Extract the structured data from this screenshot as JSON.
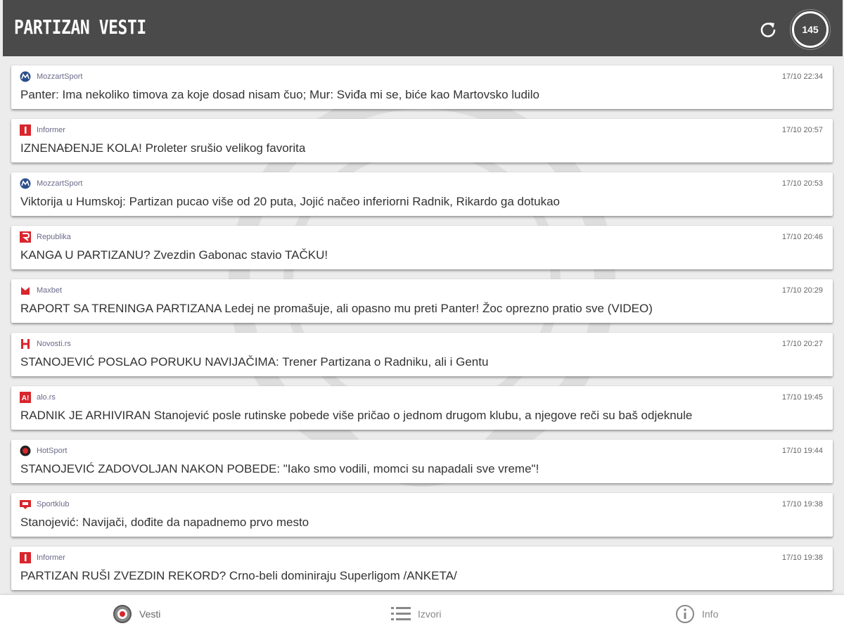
{
  "header": {
    "title": "PARTIZAN VESTI",
    "badge_count": "145"
  },
  "news": [
    {
      "source": "MozzartSport",
      "icon": "mozzart",
      "time": "17/10 22:34",
      "title": "Panter: Ima nekoliko timova za koje dosad nisam čuo; Mur: Sviđa mi se, biće kao Martovsko ludilo"
    },
    {
      "source": "Informer",
      "icon": "informer",
      "time": "17/10 20:57",
      "title": "IZNENAĐENJE KOLA! Proleter srušio velikog favorita"
    },
    {
      "source": "MozzartSport",
      "icon": "mozzart",
      "time": "17/10 20:53",
      "title": "Viktorija u Humskoj: Partizan pucao više od 20 puta, Jojić načeo inferiorni Radnik, Rikardo ga dotukao"
    },
    {
      "source": "Republika",
      "icon": "republika",
      "time": "17/10 20:46",
      "title": "KANGA U PARTIZANU? Zvezdin Gabonac stavio TAČKU!"
    },
    {
      "source": "Maxbet",
      "icon": "maxbet",
      "time": "17/10 20:29",
      "title": "RAPORT SA TRENINGA PARTIZANA Ledej ne promašuje, ali opasno mu preti Panter! Žoc oprezno pratio sve (VIDEO)"
    },
    {
      "source": "Novosti.rs",
      "icon": "novosti",
      "time": "17/10 20:27",
      "title": "STANOJEVIĆ POSLAO PORUKU NAVIJAČIMA: Trener Partizana o Radniku, ali i Gentu"
    },
    {
      "source": "alo.rs",
      "icon": "alo",
      "time": "17/10 19:45",
      "title": "RADNIK JE ARHIVIRAN Stanojević posle rutinske pobede više pričao o jednom drugom klubu, a njegove reči su baš odjeknule"
    },
    {
      "source": "HotSport",
      "icon": "hotsport",
      "time": "17/10 19:44",
      "title": "STANOJEVIĆ ZADOVOLJAN NAKON POBEDE: \"Iako smo vodili, momci su napadali sve vreme\"!"
    },
    {
      "source": "Sportklub",
      "icon": "sportklub",
      "time": "17/10 19:38",
      "title": "Stanojević: Navijači, dođite da napadnemo prvo mesto"
    },
    {
      "source": "Informer",
      "icon": "informer",
      "time": "17/10 19:38",
      "title": "PARTIZAN RUŠI ZVEZDIN REKORD? Crno-beli dominiraju Superligom /ANKETA/"
    }
  ],
  "nav": {
    "vesti": "Vesti",
    "izvori": "Izvori",
    "info": "Info"
  },
  "colors": {
    "header_bg": "#4a4a4a",
    "accent_red": "#d8262c",
    "mozzart_blue": "#2b4f8c"
  }
}
